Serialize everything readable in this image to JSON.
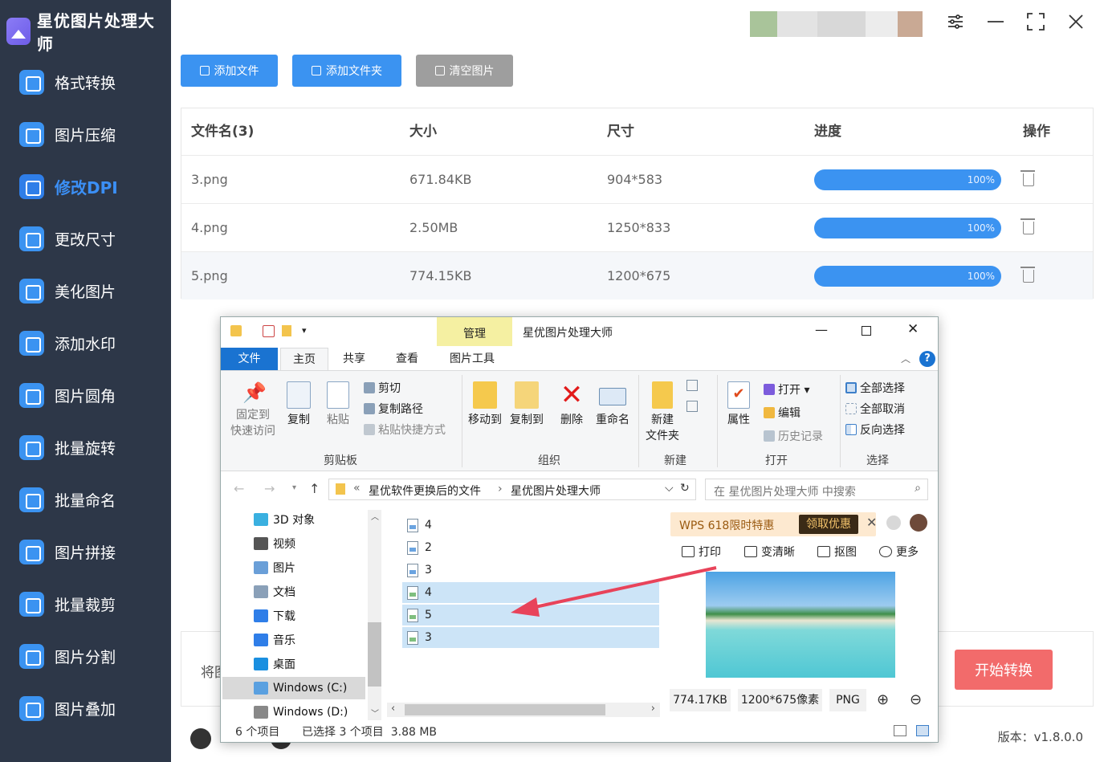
{
  "app": {
    "title": "星优图片处理大师",
    "version": "版本：v1.8.0.0"
  },
  "sidebar": {
    "items": [
      {
        "label": "格式转换",
        "icon": "format-convert-icon"
      },
      {
        "label": "图片压缩",
        "icon": "compress-icon"
      },
      {
        "label": "修改DPI",
        "icon": "dpi-icon",
        "active": true
      },
      {
        "label": "更改尺寸",
        "icon": "resize-icon"
      },
      {
        "label": "美化图片",
        "icon": "beautify-icon"
      },
      {
        "label": "添加水印",
        "icon": "watermark-icon"
      },
      {
        "label": "图片圆角",
        "icon": "round-corner-icon"
      },
      {
        "label": "批量旋转",
        "icon": "rotate-icon"
      },
      {
        "label": "批量命名",
        "icon": "rename-icon"
      },
      {
        "label": "图片拼接",
        "icon": "stitch-icon"
      },
      {
        "label": "批量裁剪",
        "icon": "crop-icon"
      },
      {
        "label": "图片分割",
        "icon": "split-icon"
      },
      {
        "label": "图片叠加",
        "icon": "overlay-icon"
      }
    ]
  },
  "toolbar": {
    "add_file": "添加文件",
    "add_folder": "添加文件夹",
    "clear": "清空图片"
  },
  "table": {
    "headers": [
      "文件名(3)",
      "大小",
      "尺寸",
      "进度",
      "操作"
    ],
    "rows": [
      {
        "name": "3.png",
        "size": "671.84KB",
        "dim": "904*583",
        "progress": "100%"
      },
      {
        "name": "4.png",
        "size": "2.50MB",
        "dim": "1250*833",
        "progress": "100%"
      },
      {
        "name": "5.png",
        "size": "774.15KB",
        "dim": "1200*675",
        "progress": "100%"
      }
    ]
  },
  "bottom": {
    "path_label": "将图",
    "start_button": "开始转换"
  },
  "explorer": {
    "title": "星优图片处理大师",
    "manage_tab": "管理",
    "tabs": [
      "文件",
      "主页",
      "共享",
      "查看",
      "图片工具"
    ],
    "ribbon": {
      "pin": "固定到\n快速访问",
      "copy": "复制",
      "paste": "粘贴",
      "cut": "剪切",
      "copy_path": "复制路径",
      "paste_shortcut": "粘贴快捷方式",
      "move_to": "移动到",
      "copy_to": "复制到",
      "delete": "删除",
      "rename": "重命名",
      "new_folder": "新建\n文件夹",
      "properties": "属性",
      "open": "打开",
      "edit": "编辑",
      "history": "历史记录",
      "select_all": "全部选择",
      "select_none": "全部取消",
      "invert": "反向选择",
      "groups": [
        "剪贴板",
        "组织",
        "新建",
        "打开",
        "选择"
      ]
    },
    "address": {
      "prefix": "«",
      "parts": [
        "星优软件更换后的文件",
        "星优图片处理大师"
      ],
      "search_placeholder": "在 星优图片处理大师 中搜索"
    },
    "tree": [
      "3D 对象",
      "视频",
      "图片",
      "文档",
      "下载",
      "音乐",
      "桌面",
      "Windows (C:)",
      "Windows (D:)"
    ],
    "files": [
      {
        "name": "4",
        "selected": false
      },
      {
        "name": "2",
        "selected": false
      },
      {
        "name": "3",
        "selected": false
      },
      {
        "name": "4",
        "selected": true
      },
      {
        "name": "5",
        "selected": true
      },
      {
        "name": "3",
        "selected": true
      }
    ],
    "preview": {
      "promo": "WPS 618限时特惠",
      "promo_button": "领取优惠",
      "actions": [
        "打印",
        "变清晰",
        "抠图",
        "更多"
      ],
      "size": "774.17KB",
      "dimensions": "1200*675像素",
      "format": "PNG"
    },
    "status": {
      "count": "6 个项目",
      "selection": "已选择 3 个项目  3.88 MB"
    }
  },
  "colors": {
    "sidebar_bg": "#2d3748",
    "primary": "#3b93f1",
    "gray_button": "#9e9e9e",
    "start_button": "#f26b6b",
    "selection": "#cce4f7",
    "arrow": "#e8435a"
  }
}
